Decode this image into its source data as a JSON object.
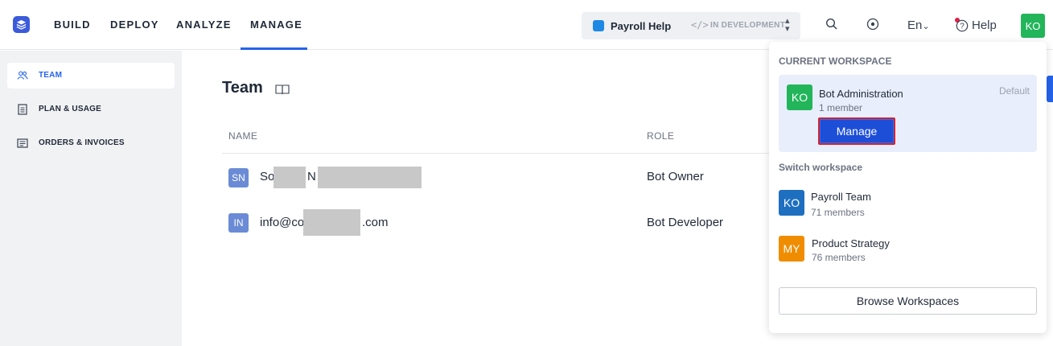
{
  "nav": {
    "items": [
      {
        "label": "BUILD"
      },
      {
        "label": "DEPLOY"
      },
      {
        "label": "ANALYZE"
      },
      {
        "label": "MANAGE"
      }
    ],
    "active": "MANAGE"
  },
  "bot_selector": {
    "name": "Payroll Help",
    "environment": "IN DEVELOPMENT",
    "env_icon": "</>"
  },
  "header": {
    "language": "En",
    "language_chevron": "⌄",
    "help_label": "Help",
    "user_initials": "KO"
  },
  "sidebar": {
    "items": [
      {
        "label": "TEAM",
        "icon": "team-icon",
        "active": true
      },
      {
        "label": "PLAN & USAGE",
        "icon": "document-icon",
        "active": false
      },
      {
        "label": "ORDERS & INVOICES",
        "icon": "invoice-icon",
        "active": false
      }
    ]
  },
  "main": {
    "title": "Team",
    "table": {
      "columns": [
        "NAME",
        "ROLE"
      ],
      "rows": [
        {
          "initials": "SN",
          "name_part1": "So",
          "name_part2": "N",
          "role": "Bot Owner"
        },
        {
          "initials": "IN",
          "name_part1": "info@co",
          "name_part2": ".com",
          "role": "Bot Developer"
        }
      ]
    }
  },
  "workspace_dropdown": {
    "current_heading": "CURRENT WORKSPACE",
    "current": {
      "initials": "KO",
      "name": "Bot Administration",
      "members": "1 member",
      "tag": "Default",
      "manage_label": "Manage"
    },
    "switch_heading": "Switch workspace",
    "others": [
      {
        "initials": "KO",
        "name": "Payroll Team",
        "members": "71 members",
        "color": "#1e6fc0"
      },
      {
        "initials": "MY",
        "name": "Product Strategy",
        "members": "76 members",
        "color": "#f08c00"
      }
    ],
    "browse_label": "Browse Workspaces"
  },
  "colors": {
    "accent": "#2563eb",
    "current_avatar": "#22b55a",
    "manage_button": "#1d4ed8",
    "highlight_border": "#d61f2c"
  }
}
